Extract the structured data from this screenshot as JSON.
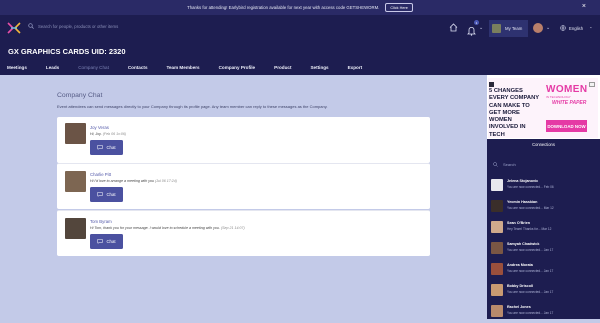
{
  "banner": {
    "text": "Thanks for attending! Earlybird registration available for next year with access code GETSHEWORM.",
    "button": "Click Here",
    "close": "×"
  },
  "header": {
    "search_placeholder": "Search for people, products or other items",
    "notification_count": "1",
    "my_team": "My Team",
    "language": "English"
  },
  "company": {
    "title": "GX GRAPHICS CARDS UID: 2320"
  },
  "tabs": [
    {
      "label": "Meetings"
    },
    {
      "label": "Leads"
    },
    {
      "label": "Company Chat"
    },
    {
      "label": "Contacts"
    },
    {
      "label": "Team Members"
    },
    {
      "label": "Company Profile"
    },
    {
      "label": "Product"
    },
    {
      "label": "Settings"
    },
    {
      "label": "Export"
    }
  ],
  "active_tab": "Company Chat",
  "main": {
    "title": "Company Chat",
    "description": "Event attendees can send messages directly to your Company through its profile page. Any team member can reply to these messages as the Company.",
    "chats": [
      {
        "name": "Joy Veras",
        "message": "Hi, Joy.",
        "date": "(Feb 06 1x:06)",
        "button": "Chat",
        "avatar_color": "#6b5446"
      },
      {
        "name": "Charlie Pitt",
        "message": "Hi I'd love to arrange a meeting with you",
        "date": "(Jul 06 17:24)",
        "button": "Chat",
        "avatar_color": "#7d6652"
      },
      {
        "name": "Tom Byram",
        "message": "Hi Tom, thank you for your message. I would love to schedule a meeting with you.",
        "date": "(Sep 21 14:07)",
        "button": "Chat",
        "avatar_color": "#53463c"
      }
    ]
  },
  "ad": {
    "headline": "5 CHANGES EVERY COMPANY CAN MAKE TO GET MORE WOMEN INVOLVED IN TECH",
    "brand": "WOMEN",
    "brand_sub": "IN TECHNOLOGY",
    "doc": "WHITE PAPER",
    "cta": "DOWNLOAD NOW"
  },
  "connections": {
    "title": "Connections",
    "search_placeholder": "Search",
    "items": [
      {
        "name": "Jelena Stojanovic",
        "msg": "You are now connected...",
        "date": "Feb 06",
        "color": "#e8e8ee"
      },
      {
        "name": "Yeomin Hasskian",
        "msg": "You are now connected...",
        "date": "Mar 12",
        "color": "#3a2e2a"
      },
      {
        "name": "Sean O'Brien",
        "msg": "Hey Team! Thanks for...",
        "date": "Mar 12",
        "color": "#cfa98c"
      },
      {
        "name": "Samyah Chadwick",
        "msg": "You are now connected...",
        "date": "Jan 17",
        "color": "#7a5644"
      },
      {
        "name": "Andrea Morata",
        "msg": "You are now connected...",
        "date": "Jan 17",
        "color": "#9a4f3c"
      },
      {
        "name": "Bobby Driscoll",
        "msg": "You are now connected...",
        "date": "Jan 17",
        "color": "#c89a72"
      },
      {
        "name": "Rachel Jones",
        "msg": "You are now connected...",
        "date": "Jan 17",
        "color": "#b98a6c"
      }
    ]
  },
  "colors": {
    "navy": "#1d1d50",
    "accent": "#4b51a0",
    "page_bg": "#c3cae8",
    "pink": "#e53aa5"
  }
}
